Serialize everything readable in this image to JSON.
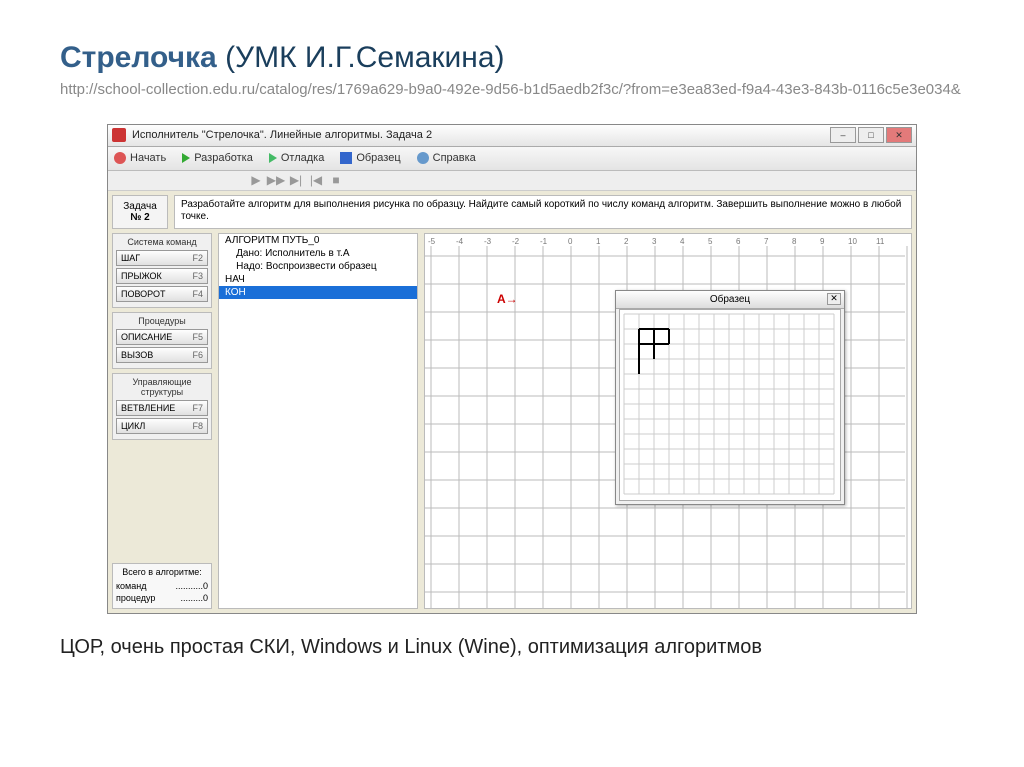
{
  "slide": {
    "title_main": "Стрелочка",
    "title_rest": " (УМК И.Г.Семакина)",
    "url": "http://school-collection.edu.ru/catalog/res/1769a629-b9a0-492e-9d56-b1d5aedb2f3c/?from=e3ea83ed-f9a4-43e3-843b-0116c5e3e034&",
    "footer": "ЦОР, очень простая СКИ, Windows и Linux (Wine), оптимизация алгоритмов"
  },
  "app": {
    "title": "Исполнитель \"Стрелочка\". Линейные алгоритмы. Задача 2",
    "menu": {
      "start": "Начать",
      "develop": "Разработка",
      "debug": "Отладка",
      "sample": "Образец",
      "help": "Справка"
    },
    "task": {
      "label_top": "Задача",
      "label_num": "№ 2",
      "text": "Разработайте алгоритм для выполнения рисунка по образцу. Найдите самый короткий по числу команд алгоритм. Завершить выполнение можно в любой точке."
    },
    "groups": {
      "commands_title": "Система команд",
      "procedures_title": "Процедуры",
      "structures_title": "Управляющие структуры",
      "stats_title": "Всего в алгоритме:"
    },
    "buttons": {
      "step": {
        "label": "ШАГ",
        "key": "F2"
      },
      "jump": {
        "label": "ПРЫЖОК",
        "key": "F3"
      },
      "turn": {
        "label": "ПОВОРОТ",
        "key": "F4"
      },
      "desc": {
        "label": "ОПИСАНИЕ",
        "key": "F5"
      },
      "call": {
        "label": "ВЫЗОВ",
        "key": "F6"
      },
      "branch": {
        "label": "ВЕТВЛЕНИЕ",
        "key": "F7"
      },
      "loop": {
        "label": "ЦИКЛ",
        "key": "F8"
      }
    },
    "stats": {
      "cmds_label": "команд",
      "cmds_value": "...........0",
      "procs_label": "процедур",
      "procs_value": ".........0"
    },
    "code": [
      "АЛГОРИТМ ПУТЬ_0",
      "    Дано: Исполнитель в т.А",
      "    Надо: Воспроизвести образец",
      "НАЧ",
      "КОН"
    ],
    "code_selected_index": 4,
    "obrazec_title": "Образец",
    "grid_minX": -5,
    "grid_maxX": 11,
    "marker_label": "A"
  }
}
